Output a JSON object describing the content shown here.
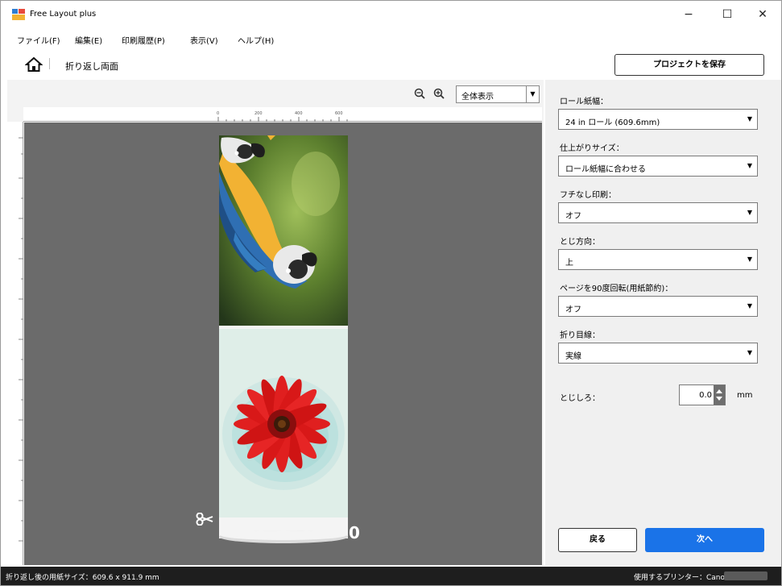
{
  "window": {
    "title": "Free Layout plus",
    "minimize_glyph": "−",
    "maximize_glyph": "☐",
    "close_glyph": "✕"
  },
  "menu": {
    "items": [
      {
        "label": "ファイル(F)"
      },
      {
        "label": "編集(E)"
      },
      {
        "label": "印刷履歴(P)"
      },
      {
        "label": "表示(V)"
      },
      {
        "label": "ヘルプ(H)"
      }
    ]
  },
  "breadcrumb": {
    "current": "折り返し両面"
  },
  "toolbar": {
    "save_project_label": "プロジェクトを保存"
  },
  "preview": {
    "zoom_select_value": "全体表示",
    "ruler_marks": [
      "0",
      "200",
      "400",
      "600"
    ],
    "end_mark": "0"
  },
  "settings": {
    "roll_width": {
      "label": "ロール紙幅：",
      "value": "24 in ロール (609.6mm)"
    },
    "finish_size": {
      "label": "仕上がりサイズ：",
      "value": "ロール紙幅に合わせる"
    },
    "borderless": {
      "label": "フチなし印刷：",
      "value": "オフ"
    },
    "binding_side": {
      "label": "とじ方向：",
      "value": "上"
    },
    "rotate_page": {
      "label": "ページを90度回転(用紙節約)：",
      "value": "オフ"
    },
    "fold_line": {
      "label": "折り目線：",
      "value": "実線"
    },
    "binding_margin": {
      "label": "とじしろ：",
      "value": "0.0",
      "unit": "mm"
    }
  },
  "buttons": {
    "back_label": "戻る",
    "next_label": "次へ"
  },
  "status": {
    "paper_size": "折り返し後の用紙サイズ：609.6 x 911.9 mm",
    "printer": "使用するプリンター：Canon"
  },
  "colors": {
    "accent": "#1a73e8",
    "canvas_bg": "#6b6b6b",
    "statusbar_bg": "#1e1e1e"
  }
}
